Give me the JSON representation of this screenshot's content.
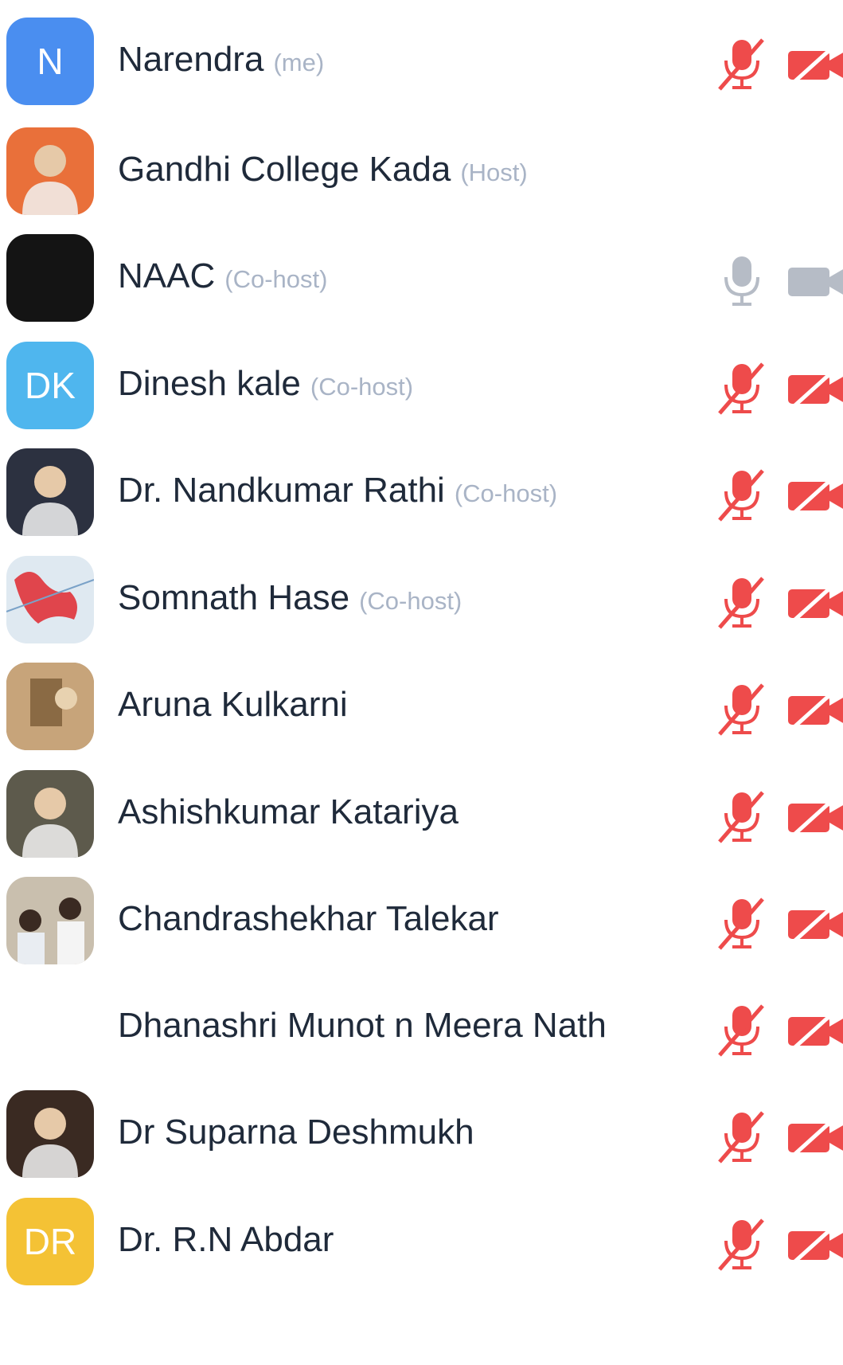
{
  "participants": [
    {
      "name": "Narendra",
      "role": "(me)",
      "avatar": {
        "type": "initials",
        "text": "N",
        "color": "#4a8ef0"
      },
      "mic": "muted",
      "cam": "off"
    },
    {
      "name": "Gandhi College Kada",
      "role": "(Host)",
      "avatar": {
        "type": "photo",
        "icon": "person-photo-icon",
        "color": "#e9703a"
      },
      "mic": "none",
      "cam": "none"
    },
    {
      "name": "NAAC",
      "role": "(Co-host)",
      "avatar": {
        "type": "photo",
        "icon": "dark-logo-icon",
        "color": "#141414"
      },
      "mic": "on",
      "cam": "on"
    },
    {
      "name": "Dinesh kale",
      "role": "(Co-host)",
      "avatar": {
        "type": "initials",
        "text": "DK",
        "color": "#4fb6ee"
      },
      "mic": "muted",
      "cam": "off"
    },
    {
      "name": "Dr. Nandkumar Rathi",
      "role": "(Co-host)",
      "avatar": {
        "type": "photo",
        "icon": "speaker-photo-icon",
        "color": "#2c3140"
      },
      "mic": "muted",
      "cam": "off"
    },
    {
      "name": "Somnath Hase",
      "role": "(Co-host)",
      "avatar": {
        "type": "photo",
        "icon": "map-photo-icon",
        "color": "#dfe9f1"
      },
      "mic": "muted",
      "cam": "off"
    },
    {
      "name": "Aruna Kulkarni",
      "role": "",
      "avatar": {
        "type": "photo",
        "icon": "room-photo-icon",
        "color": "#a88258"
      },
      "mic": "muted",
      "cam": "off"
    },
    {
      "name": "Ashishkumar Katariya",
      "role": "",
      "avatar": {
        "type": "photo",
        "icon": "person-photo-icon",
        "color": "#5d5a4c"
      },
      "mic": "muted",
      "cam": "off"
    },
    {
      "name": "Chandrashekhar Talekar",
      "role": "",
      "avatar": {
        "type": "photo",
        "icon": "couple-photo-icon",
        "color": "#c9bfae"
      },
      "mic": "muted",
      "cam": "off"
    },
    {
      "name": "Dhanashri Munot n Meera Nath",
      "role": "",
      "avatar": {
        "type": "none"
      },
      "mic": "muted",
      "cam": "off"
    },
    {
      "name": "Dr Suparna Deshmukh",
      "role": "",
      "avatar": {
        "type": "photo",
        "icon": "portrait-photo-icon",
        "color": "#3a2a22"
      },
      "mic": "muted",
      "cam": "off"
    },
    {
      "name": "Dr. R.N Abdar",
      "role": "",
      "avatar": {
        "type": "initials",
        "text": "DR",
        "color": "#f4c235"
      },
      "mic": "muted",
      "cam": "off"
    }
  ],
  "colors": {
    "muted": "#ee4b4b",
    "active": "#b6bcc6",
    "name": "#1f2a3a",
    "role": "#a9b4c6"
  }
}
